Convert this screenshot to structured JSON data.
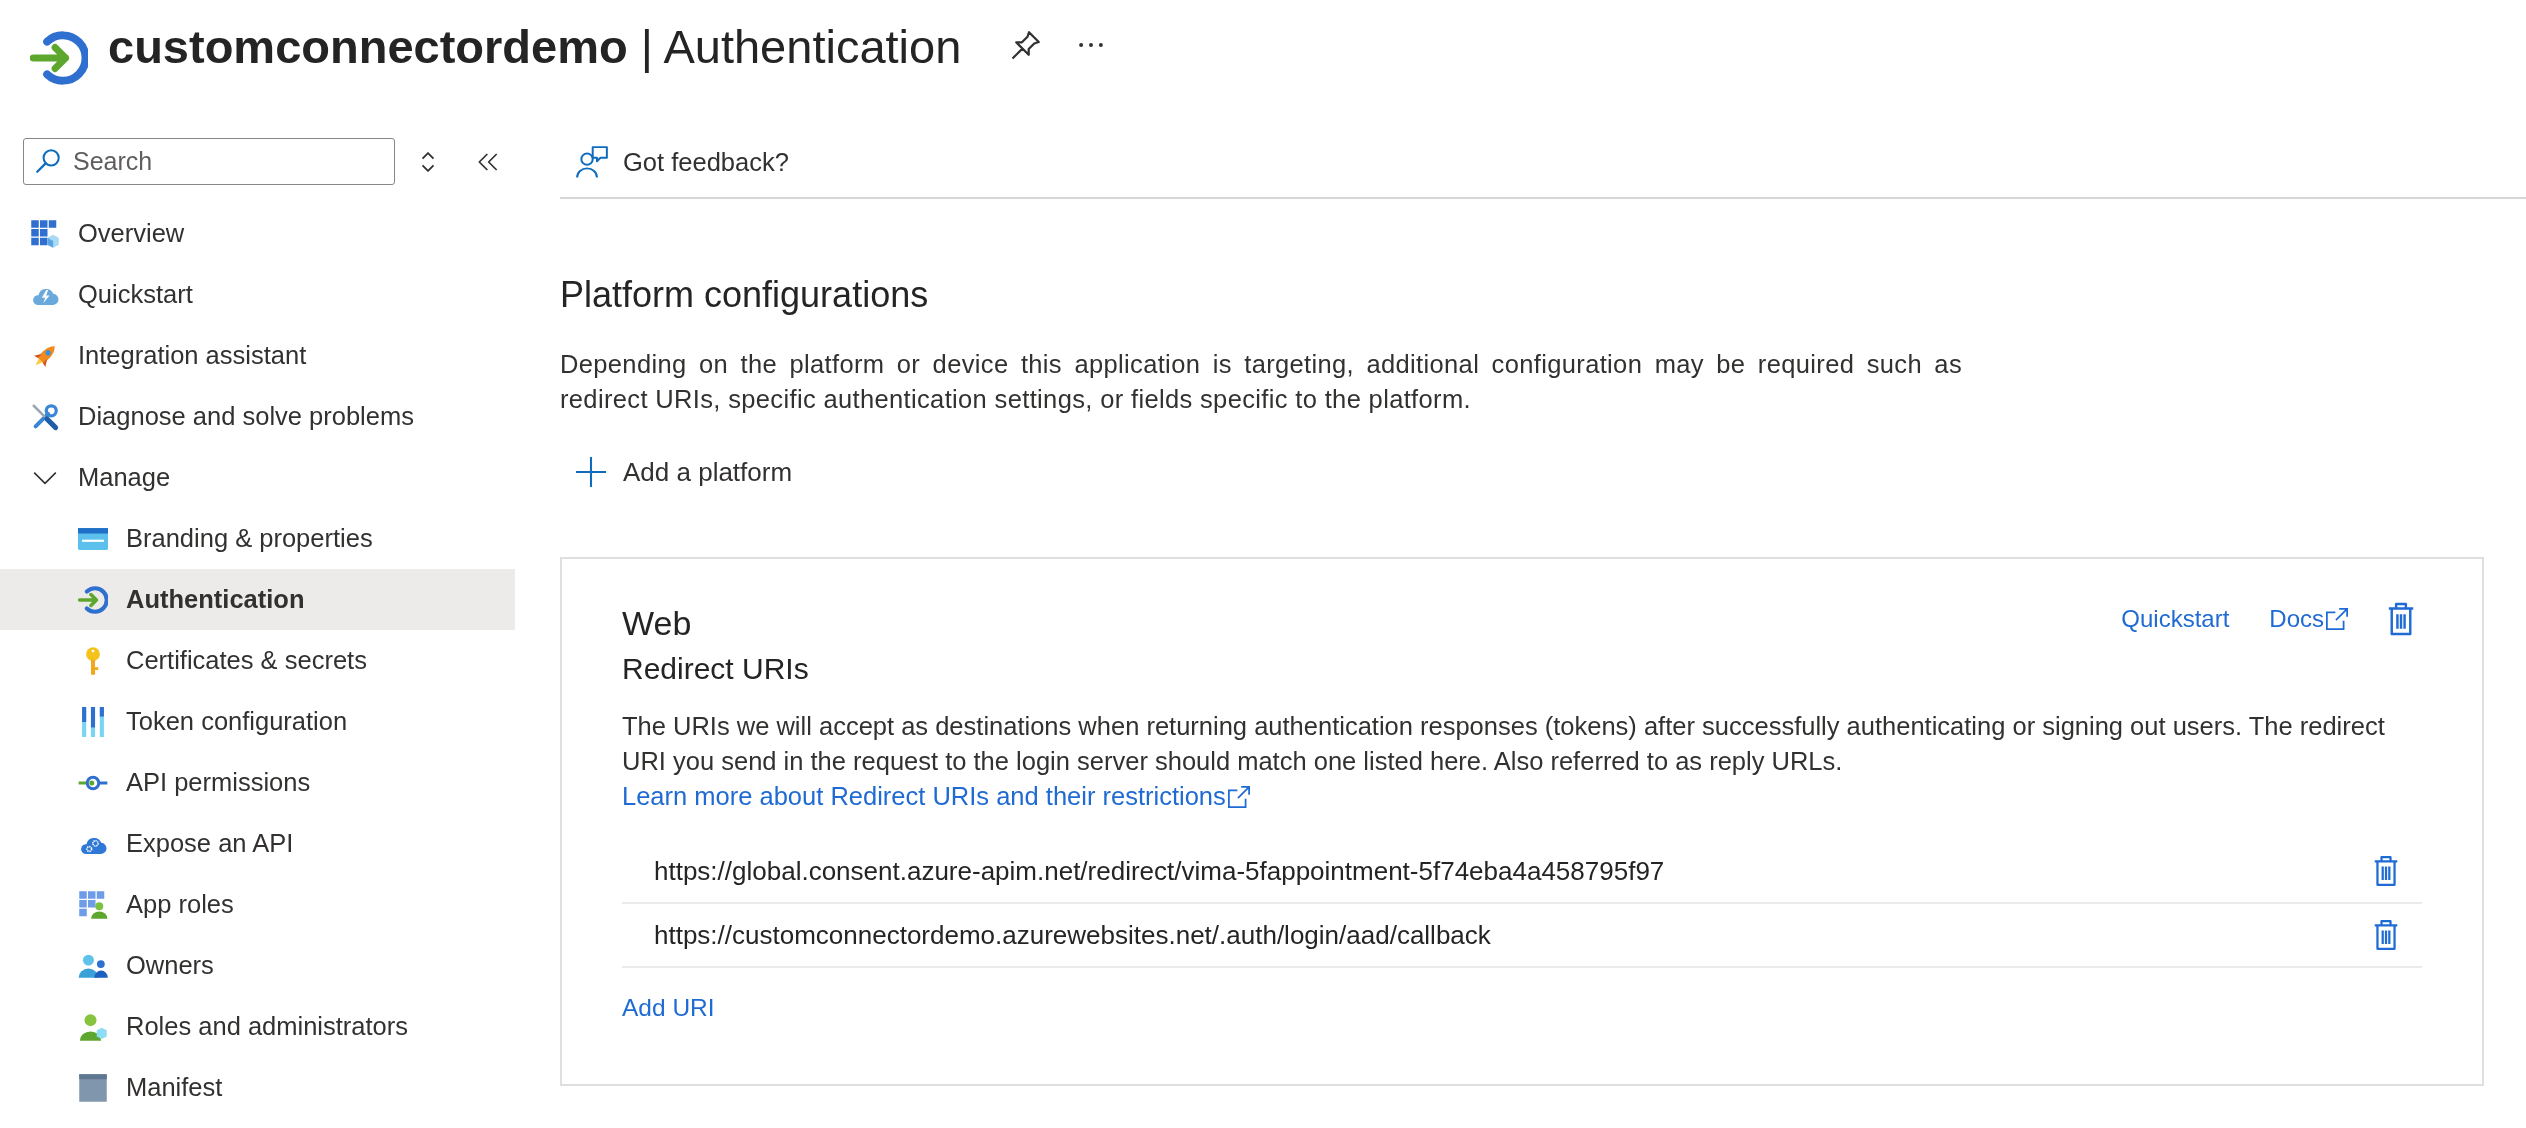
{
  "header": {
    "title": "**customconnectordemo** | Authentication"
  },
  "sidebar": {
    "search": {
      "placeholder": "Search"
    },
    "items": [
      {
        "label": "Overview",
        "selected": false
      },
      {
        "label": "Quickstart",
        "selected": false
      },
      {
        "label": "Integration assistant",
        "selected": false
      },
      {
        "label": "Diagnose and solve problems",
        "selected": false
      },
      {
        "label": "Manage",
        "selected": false,
        "expanded": true,
        "children": [
          {
            "label": "Branding & properties",
            "selected": false
          },
          {
            "label": "Authentication",
            "selected": true
          },
          {
            "label": "Certificates & secrets",
            "selected": false
          },
          {
            "label": "Token configuration",
            "selected": false
          },
          {
            "label": "API permissions",
            "selected": false
          },
          {
            "label": "Expose an API",
            "selected": false
          },
          {
            "label": "App roles",
            "selected": false
          },
          {
            "label": "Owners",
            "selected": false
          },
          {
            "label": "Roles and administrators",
            "selected": false
          },
          {
            "label": "Manifest",
            "selected": false
          }
        ]
      }
    ]
  },
  "toolbar": {
    "feedback": "Got feedback?"
  },
  "platform": {
    "title": "Platform configurations",
    "description": "Depending on the platform or device this application is targeting, additional configuration may be required such as redirect URIs, specific authentication settings, or fields specific to the platform.",
    "add_button": "Add a platform"
  },
  "web_card": {
    "title": "Web",
    "links": [
      {
        "label": "Quickstart",
        "external": false
      },
      {
        "label": "Docs",
        "external": true
      }
    ],
    "section_title": "Redirect URIs",
    "description": "The URIs we will accept as destinations when returning authentication responses (tokens) after successfully authenticating or signing out users. The redirect URI you send in the request to the login server should match one listed here. Also referred to as reply URLs.",
    "learn_more": {
      "label": "Learn more about Redirect URIs and their restrictions",
      "external": true
    },
    "uris": [
      "https://global.consent.azure-apim.net/redirect/vima-5fappointment-5f74eba4a458795f97",
      "https://customconnectordemo.azurewebsites.net/.auth/login/aad/callback"
    ],
    "add_uri": "Add URI"
  }
}
